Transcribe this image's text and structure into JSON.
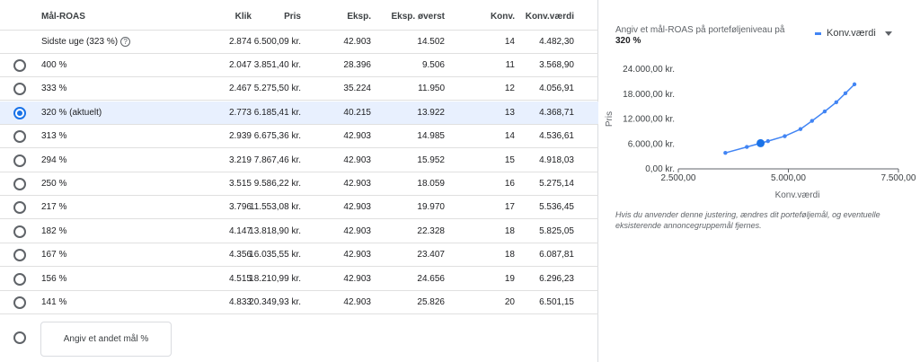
{
  "table": {
    "headers": {
      "label": "Mål-ROAS",
      "klik": "Klik",
      "pris": "Pris",
      "eksp": "Eksp.",
      "top": "Eksp. øverst",
      "conv": "Konv.",
      "val": "Konv.værdi"
    },
    "summary": {
      "label": "Sidste uge (323 %)",
      "klik": "2.874",
      "pris": "6.500,09 kr.",
      "eksp": "42.903",
      "top": "14.502",
      "conv": "14",
      "val": "4.482,30"
    },
    "rows": [
      {
        "label": "400 %",
        "klik": "2.047",
        "pris": "3.851,40 kr.",
        "eksp": "28.396",
        "top": "9.506",
        "conv": "11",
        "val": "3.568,90",
        "selected": false
      },
      {
        "label": "333 %",
        "klik": "2.467",
        "pris": "5.275,50 kr.",
        "eksp": "35.224",
        "top": "11.950",
        "conv": "12",
        "val": "4.056,91",
        "selected": false
      },
      {
        "label": "320 % (aktuelt)",
        "klik": "2.773",
        "pris": "6.185,41 kr.",
        "eksp": "40.215",
        "top": "13.922",
        "conv": "13",
        "val": "4.368,71",
        "selected": true
      },
      {
        "label": "313 %",
        "klik": "2.939",
        "pris": "6.675,36 kr.",
        "eksp": "42.903",
        "top": "14.985",
        "conv": "14",
        "val": "4.536,61",
        "selected": false
      },
      {
        "label": "294 %",
        "klik": "3.219",
        "pris": "7.867,46 kr.",
        "eksp": "42.903",
        "top": "15.952",
        "conv": "15",
        "val": "4.918,03",
        "selected": false
      },
      {
        "label": "250 %",
        "klik": "3.515",
        "pris": "9.586,22 kr.",
        "eksp": "42.903",
        "top": "18.059",
        "conv": "16",
        "val": "5.275,14",
        "selected": false
      },
      {
        "label": "217 %",
        "klik": "3.796",
        "pris": "11.553,08 kr.",
        "eksp": "42.903",
        "top": "19.970",
        "conv": "17",
        "val": "5.536,45",
        "selected": false
      },
      {
        "label": "182 %",
        "klik": "4.147",
        "pris": "13.818,90 kr.",
        "eksp": "42.903",
        "top": "22.328",
        "conv": "18",
        "val": "5.825,05",
        "selected": false
      },
      {
        "label": "167 %",
        "klik": "4.356",
        "pris": "16.035,55 kr.",
        "eksp": "42.903",
        "top": "23.407",
        "conv": "18",
        "val": "6.087,81",
        "selected": false
      },
      {
        "label": "156 %",
        "klik": "4.515",
        "pris": "18.210,99 kr.",
        "eksp": "42.903",
        "top": "24.656",
        "conv": "19",
        "val": "6.296,23",
        "selected": false
      },
      {
        "label": "141 %",
        "klik": "4.833",
        "pris": "20.349,93 kr.",
        "eksp": "42.903",
        "top": "25.826",
        "conv": "20",
        "val": "6.501,15",
        "selected": false
      }
    ],
    "other_button": "Angiv et andet mål %"
  },
  "panel": {
    "title": "Angiv et mål-ROAS på porteføljeniveau på",
    "title_value": "320 %",
    "legend_selector": "Konv.værdi",
    "note": "Hvis du anvender denne justering, ændres dit porteføljemål, og eventuelle eksisterende annoncegruppemål fjernes."
  },
  "icons": {
    "help": "help-circle-icon",
    "dropdown": "chevron-down-icon",
    "radio": "radio-button-icon"
  },
  "colors": {
    "accent": "#1a73e8",
    "series": "#4285f4",
    "selected_row": "#e8f0fe"
  },
  "chart_data": {
    "type": "line",
    "xlabel": "Konv.værdi",
    "ylabel": "Pris",
    "xlim": [
      2500,
      7500
    ],
    "ylim": [
      0,
      24000
    ],
    "x_ticks": [
      2500,
      5000,
      7500
    ],
    "x_tick_labels": [
      "2.500,00",
      "5.000,00",
      "7.500,00"
    ],
    "y_ticks": [
      0,
      6000,
      12000,
      18000,
      24000
    ],
    "y_tick_labels": [
      "0,00 kr.",
      "6.000,00 kr.",
      "12.000,00 kr.",
      "18.000,00 kr.",
      "24.000,00 kr."
    ],
    "grid": false,
    "legend": "top-right",
    "series": [
      {
        "name": "Konv.værdi",
        "x": [
          3568.9,
          4056.91,
          4368.71,
          4536.61,
          4918.03,
          5275.14,
          5536.45,
          5825.05,
          6087.81,
          6296.23,
          6501.15
        ],
        "y": [
          3851.4,
          5275.5,
          6185.41,
          6675.36,
          7867.46,
          9586.22,
          11553.08,
          13818.9,
          16035.55,
          18210.99,
          20349.93
        ]
      }
    ],
    "highlight": {
      "x": 4368.71,
      "y": 6185.41
    }
  }
}
